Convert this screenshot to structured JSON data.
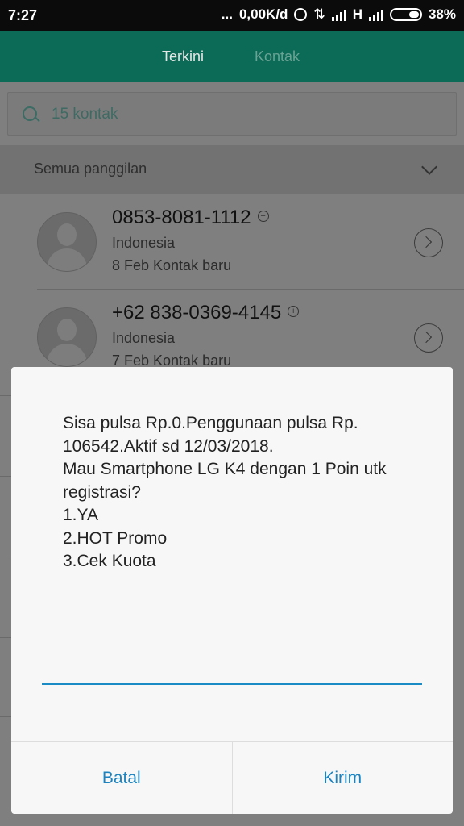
{
  "status": {
    "time": "7:27",
    "dots": "...",
    "speed": "0,00K/d",
    "network": "H",
    "battery": "38%"
  },
  "tabs": [
    {
      "label": "Terkini"
    },
    {
      "label": "Kontak"
    }
  ],
  "search": {
    "placeholder": "15 kontak"
  },
  "filter": {
    "label": "Semua panggilan"
  },
  "calls": [
    {
      "number": "0853-8081-1112",
      "region": "Indonesia",
      "detail": "8 Feb Kontak baru"
    },
    {
      "number": "+62 838-0369-4145",
      "region": "Indonesia",
      "detail": "7 Feb Kontak baru"
    }
  ],
  "dialog": {
    "message": "Sisa pulsa Rp.0.Penggunaan pulsa Rp. 106542.Aktif sd 12/03/2018.\nMau Smartphone LG K4 dengan 1 Poin utk registrasi?\n1.YA\n2.HOT Promo\n3.Cek Kuota",
    "cancel_label": "Batal",
    "send_label": "Kirim"
  }
}
